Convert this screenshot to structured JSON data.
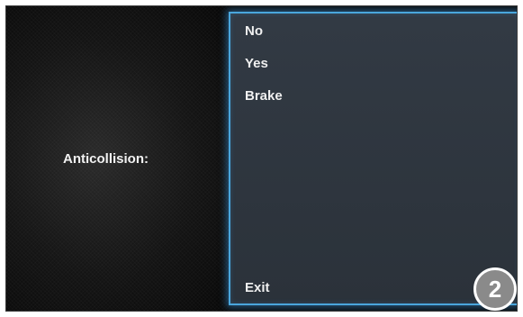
{
  "screen": {
    "setting_label": "Anticollision:"
  },
  "menu": {
    "items": [
      {
        "label": "No"
      },
      {
        "label": "Yes"
      },
      {
        "label": "Brake"
      }
    ],
    "exit_label": "Exit"
  },
  "badge": {
    "number": "2"
  },
  "colors": {
    "panel_border": "#4aa6dc",
    "panel_bg": "#2e353e",
    "text": "#f0f0f0",
    "badge_bg": "#8a8a8a"
  }
}
